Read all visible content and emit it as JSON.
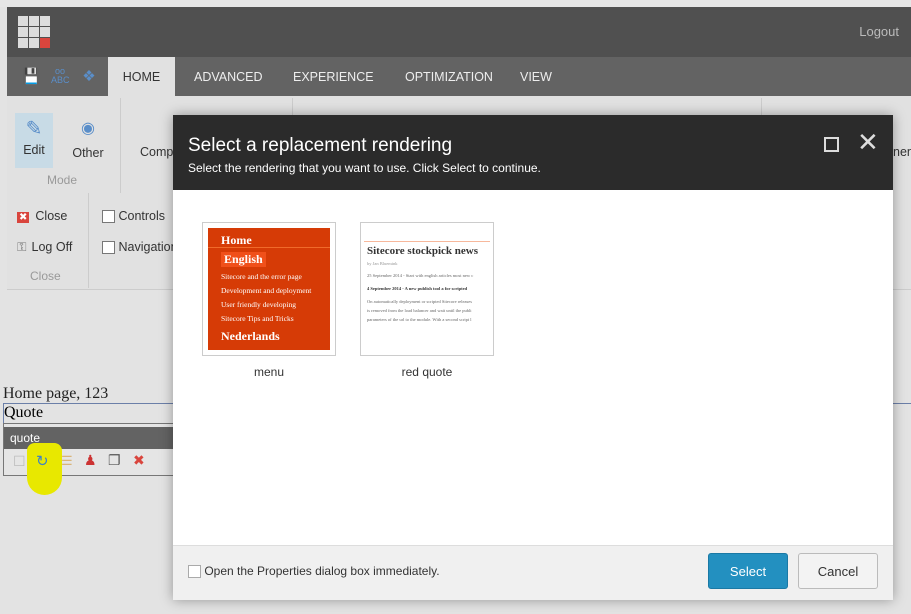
{
  "header": {
    "logout": "Logout"
  },
  "tabs": [
    "HOME",
    "ADVANCED",
    "EXPERIENCE",
    "OPTIMIZATION",
    "VIEW"
  ],
  "ribbon": {
    "edit": "Edit",
    "other": "Other",
    "mode_group": "Mode",
    "components": "Comp",
    "close": "Close",
    "logoff": "Log Off",
    "close_group": "Close",
    "controls": "Controls",
    "navigation": "Navigation",
    "right_partial": "nen"
  },
  "page": {
    "title": "Home page, 123",
    "quote": "Quote",
    "chrome_label": "quote"
  },
  "dialog": {
    "title": "Select a replacement rendering",
    "subtitle": "Select the rendering that you want to use. Click Select to continue.",
    "renderings": [
      {
        "label": "menu",
        "preview": {
          "home": "Home",
          "english": "English",
          "items": [
            "Sitecore and the error page",
            "Development and deployment",
            "User friendly developing",
            "Sitecore Tips and Tricks"
          ],
          "nl": "Nederlands"
        }
      },
      {
        "label": "red quote",
        "preview": {
          "title": "Sitecore stockpick news",
          "by": "by Jan Bluemink",
          "lines": [
            "25 September 2014 - Start with english articles most new c",
            "4 September 2014 - A new publish tool a for scripted",
            "On automatically deployment or scripted Sitecore releases",
            "is removed from the load balancer and wait until the publi",
            "parameters of the url to the module. With a second script l"
          ]
        }
      }
    ],
    "checkbox_label": "Open the Properties dialog box immediately.",
    "select": "Select",
    "cancel": "Cancel"
  },
  "colors": {
    "accent": "#2390c0",
    "menu_bg": "#d63b06",
    "highlight": "#e8e800"
  }
}
